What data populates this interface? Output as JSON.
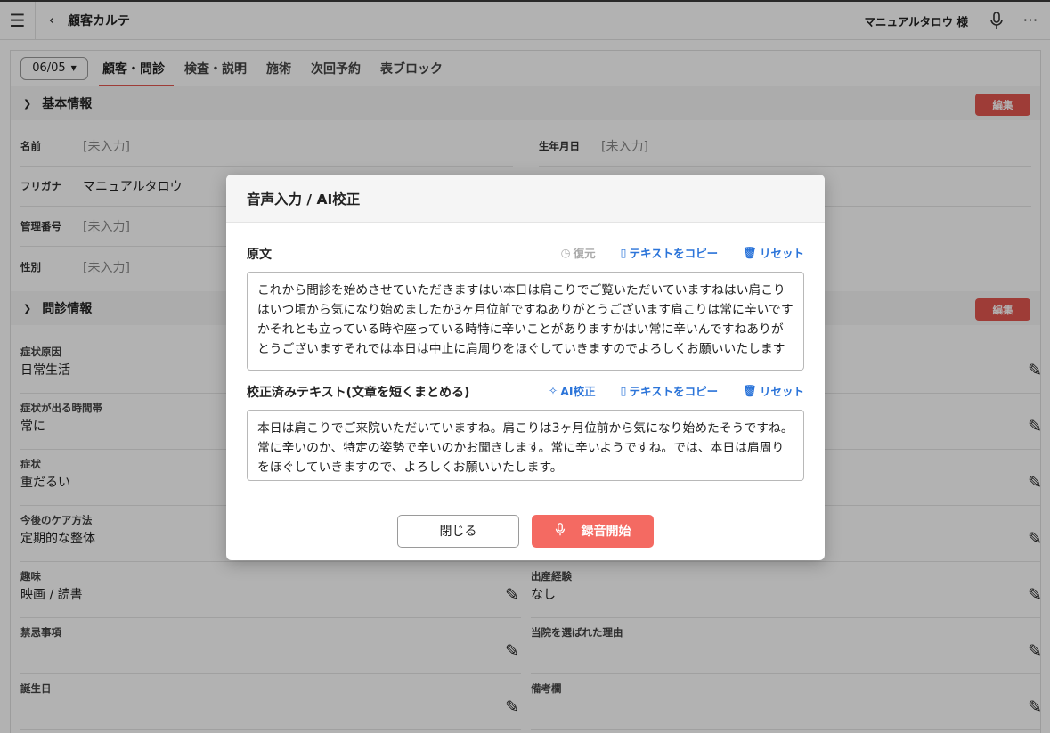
{
  "header": {
    "title": "顧客カルテ",
    "customer_name": "マニュアルタロウ 様"
  },
  "tabs": {
    "date": "06/05",
    "items": [
      {
        "label": "顧客・問診"
      },
      {
        "label": "検査・説明"
      },
      {
        "label": "施術"
      },
      {
        "label": "次回予約"
      },
      {
        "label": "表ブロック"
      }
    ]
  },
  "basic_info": {
    "heading": "基本情報",
    "edit_label": "編集",
    "name_label": "名前",
    "name_value": "[未入力]",
    "birth_label": "生年月日",
    "birth_value": "[未入力]",
    "kana_label": "フリガナ",
    "kana_value": "マニュアルタロウ",
    "id_label": "管理番号",
    "id_value": "[未入力]",
    "gender_label": "性別",
    "gender_value": "[未入力]"
  },
  "interview": {
    "heading": "問診情報",
    "edit_label": "編集",
    "fields": [
      {
        "label": "症状原因",
        "value": "日常生活"
      },
      {
        "label": "症状が出る時間帯",
        "value": "常に"
      },
      {
        "label": "症状",
        "value": "重だるい"
      },
      {
        "label": "今後のケア方法",
        "value": "定期的な整体"
      },
      {
        "label": "趣味",
        "value": "映画 / 読書"
      },
      {
        "label": "出産経験",
        "value": "なし"
      },
      {
        "label": "禁忌事項",
        "value": ""
      },
      {
        "label": "当院を選ばれた理由",
        "value": ""
      },
      {
        "label": "誕生日",
        "value": ""
      },
      {
        "label": "備考欄",
        "value": ""
      }
    ]
  },
  "modal": {
    "title": "音声入力 / AI校正",
    "original_label": "原文",
    "restore_label": "復元",
    "copy_label": "テキストをコピー",
    "reset_label": "リセット",
    "original_text": "これから問診を始めさせていただきますはい本日は肩こりでご覧いただいていますねはい肩こりはいつ頃から気になり始めましたか3ヶ月位前ですねありがとうございます肩こりは常に辛いですかそれとも立っている時や座っている時特に辛いことがありますかはい常に辛いんですねありがとうございますそれでは本日は中止に肩周りをほぐしていきますのでよろしくお願いいたします",
    "corrected_label": "校正済みテキスト(文章を短くまとめる)",
    "ai_label": "AI校正",
    "copy_label2": "テキストをコピー",
    "reset_label2": "リセット",
    "corrected_text": "本日は肩こりでご来院いただいていますね。肩こりは3ヶ月位前から気になり始めたそうですね。常に辛いのか、特定の姿勢で辛いのかお聞きします。常に辛いようですね。では、本日は肩周りをほぐしていきますので、よろしくお願いいたします。",
    "close_label": "閉じる",
    "record_label": "録音開始"
  }
}
